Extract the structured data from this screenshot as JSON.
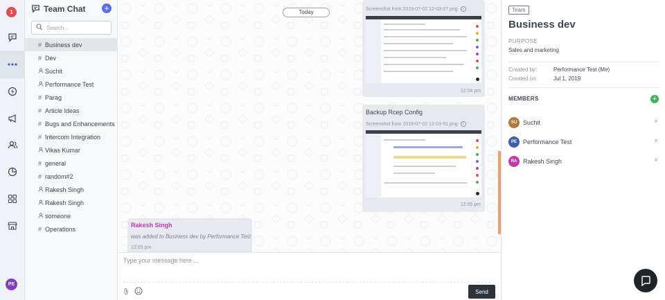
{
  "rail": {
    "badge": "1",
    "icons": [
      "chat-icon",
      "more-icon",
      "bolt-icon",
      "megaphone-icon",
      "people-icon",
      "chart-icon",
      "apps-icon",
      "store-icon"
    ],
    "avatar": "PE"
  },
  "sidebar": {
    "title": "Team Chat",
    "add_label": "+",
    "search_placeholder": "Search...",
    "channels": [
      {
        "type": "#",
        "name": "Business dev",
        "active": true
      },
      {
        "type": "#",
        "name": "Dev"
      },
      {
        "type": "user",
        "name": "Suchit"
      },
      {
        "type": "user",
        "name": "Performance Test"
      },
      {
        "type": "#",
        "name": "Parag"
      },
      {
        "type": "#",
        "name": "Article Ideas"
      },
      {
        "type": "#",
        "name": "Bugs and Enhancements"
      },
      {
        "type": "#",
        "name": "Intercom Integration"
      },
      {
        "type": "user",
        "name": "Vikas Kumar"
      },
      {
        "type": "#",
        "name": "general"
      },
      {
        "type": "#",
        "name": "random#2"
      },
      {
        "type": "user",
        "name": "Rakesh Singh"
      },
      {
        "type": "user",
        "name": "Rakesh Singh"
      },
      {
        "type": "user",
        "name": "someone"
      },
      {
        "type": "#",
        "name": "Operations"
      }
    ]
  },
  "chat": {
    "date_divider": "Today",
    "messages": [
      {
        "caption": "Screenshot from 2019-07-02 12-03-27.png",
        "time": "12:04 pm"
      },
      {
        "title": "Backup Rcep Config",
        "caption": "Screenshot from 2019-07-02 12-03-51.png",
        "time": "12:05 pm"
      }
    ],
    "system_message": {
      "sender": "Rakesh Singh",
      "text": "was added to Business dev by Performance Test",
      "time": "12:05 pm"
    },
    "composer": {
      "placeholder": "Type your message here ...",
      "send_label": "Send"
    }
  },
  "details": {
    "tag": "Team",
    "name": "Business dev",
    "purpose_label": "PURPOSE",
    "purpose": "Sales and marketing",
    "created_by_label": "Created by:",
    "created_by": "Performance Test (Me)",
    "created_on_label": "Created on:",
    "created_on": "Jul 1, 2019",
    "members_label": "MEMBERS",
    "members": [
      {
        "initials": "SU",
        "name": "Suchit",
        "color": "#b07a3b"
      },
      {
        "initials": "PE",
        "name": "Performance Test",
        "color": "#3f5ea8"
      },
      {
        "initials": "RA",
        "name": "Rakesh Singh",
        "color": "#c13aa8"
      }
    ]
  },
  "colors": {
    "accent": "#5b6ee1",
    "badge": "#e5484d",
    "add_member": "#3fb35a",
    "send_button": "#2d333b",
    "sender_name": "#c13aa8"
  }
}
